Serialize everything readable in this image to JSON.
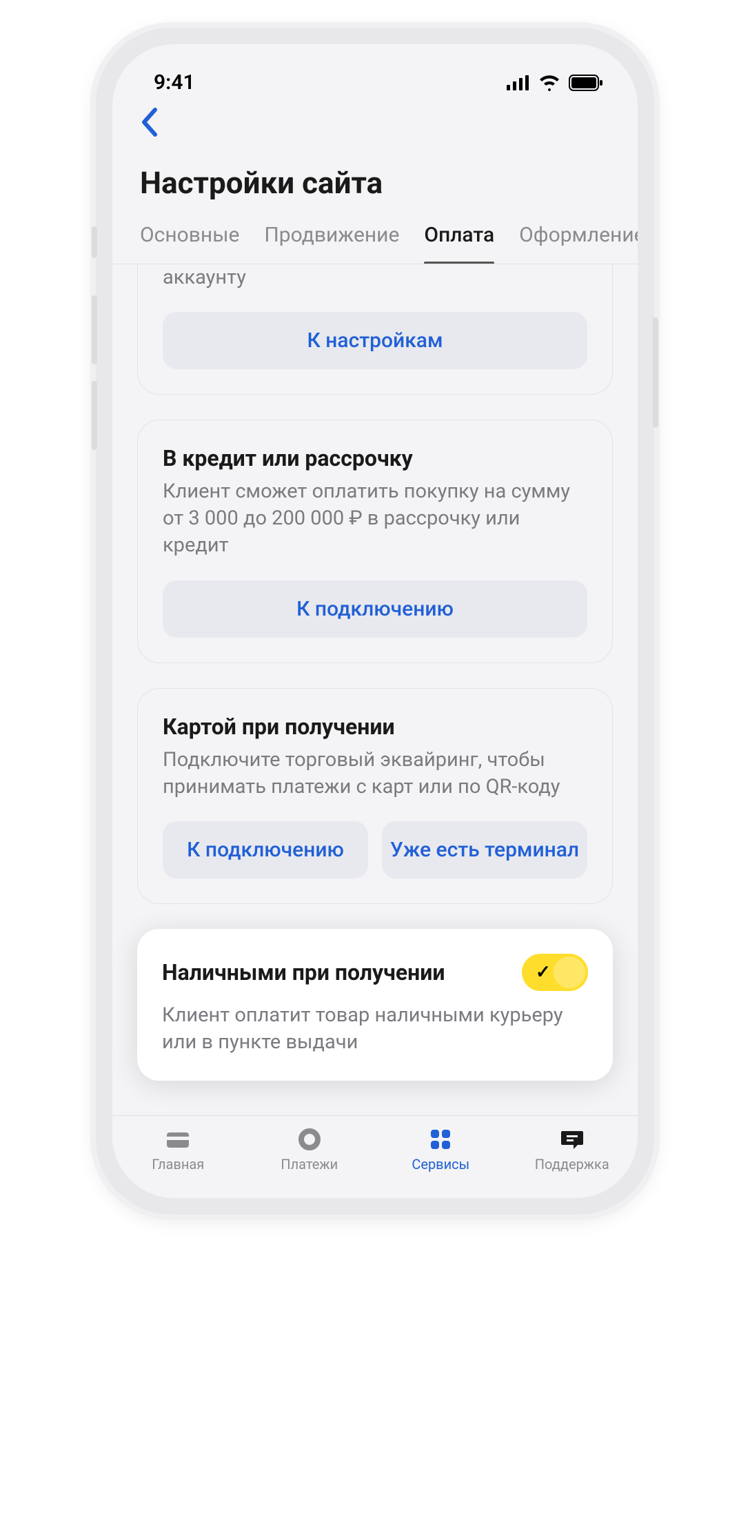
{
  "status": {
    "time": "9:41"
  },
  "page_title": "Настройки сайта",
  "tabs": [
    {
      "label": "Основные",
      "active": false
    },
    {
      "label": "Продвижение",
      "active": false
    },
    {
      "label": "Оплата",
      "active": true
    },
    {
      "label": "Оформление заказа",
      "active": false
    }
  ],
  "cards": {
    "account_partial": {
      "text": "аккаунту",
      "button": "К настройкам"
    },
    "credit": {
      "title": "В кредит или рассрочку",
      "desc": "Клиент сможет оплатить покупку на сумму от 3 000 до 200 000 ₽ в рассрочку или кредит",
      "button": "К подключению"
    },
    "card_on_delivery": {
      "title": "Картой при получении",
      "desc": "Подключите торговый эквайринг, чтобы принимать платежи с карт или по QR-коду",
      "button_primary": "К подключению",
      "button_secondary": "Уже есть терминал"
    },
    "cash_on_delivery": {
      "title": "Наличными при получении",
      "desc": "Клиент оплатит товар наличными курьеру или в пункте выдачи",
      "toggle_on": true
    }
  },
  "nav": [
    {
      "label": "Главная"
    },
    {
      "label": "Платежи"
    },
    {
      "label": "Сервисы"
    },
    {
      "label": "Поддержка"
    }
  ]
}
